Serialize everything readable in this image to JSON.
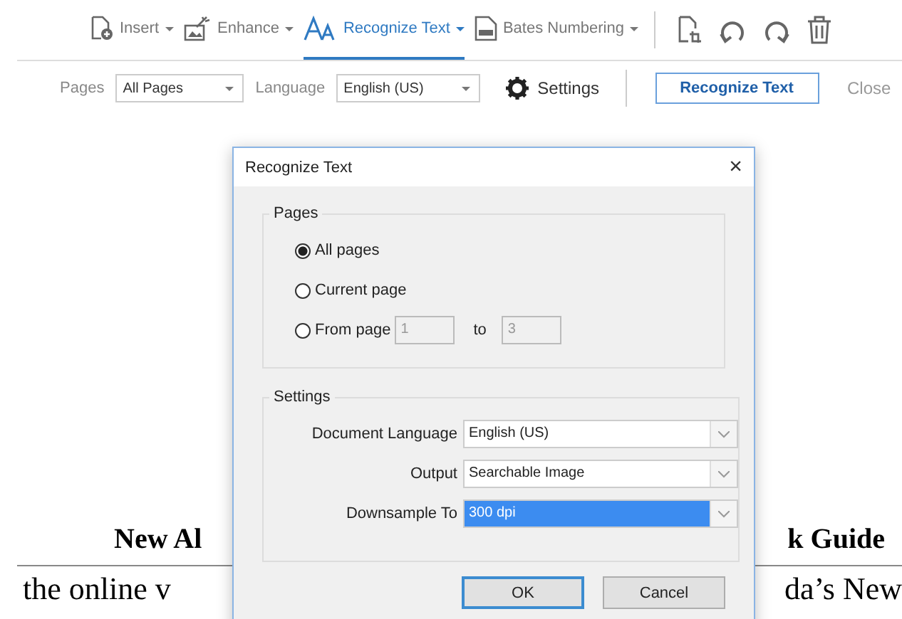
{
  "toolbar": {
    "tools": [
      {
        "label": "Insert",
        "selected": false
      },
      {
        "label": "Enhance",
        "selected": false
      },
      {
        "label": "Recognize Text",
        "selected": true
      },
      {
        "label": "Bates Numbering",
        "selected": false
      }
    ]
  },
  "options_bar": {
    "pages_label": "Pages",
    "pages_value": "All Pages",
    "language_label": "Language",
    "language_value": "English (US)",
    "settings": "Settings",
    "primary": "Recognize Text",
    "close": "Close"
  },
  "document": {
    "heading_left": "New Al",
    "heading_right": "k Guide",
    "line_left": "the online v",
    "line_right": "da’s New"
  },
  "dialog": {
    "title": "Recognize Text",
    "close": "×",
    "pages_group": {
      "title": "Pages",
      "options": [
        {
          "label": "All pages",
          "selected": true
        },
        {
          "label": "Current page",
          "selected": false
        },
        {
          "label": "From page",
          "selected": false
        }
      ],
      "from": "1",
      "to_label": "to",
      "to": "3"
    },
    "settings_group": {
      "title": "Settings",
      "fields": [
        {
          "label": "Document Language",
          "value": "English (US)",
          "selected": false
        },
        {
          "label": "Output",
          "value": "Searchable Image",
          "selected": false
        },
        {
          "label": "Downsample To",
          "value": "300 dpi",
          "selected": true
        }
      ]
    },
    "buttons": [
      {
        "label": "OK",
        "kind": "default"
      },
      {
        "label": "Cancel",
        "kind": "normal"
      }
    ]
  }
}
